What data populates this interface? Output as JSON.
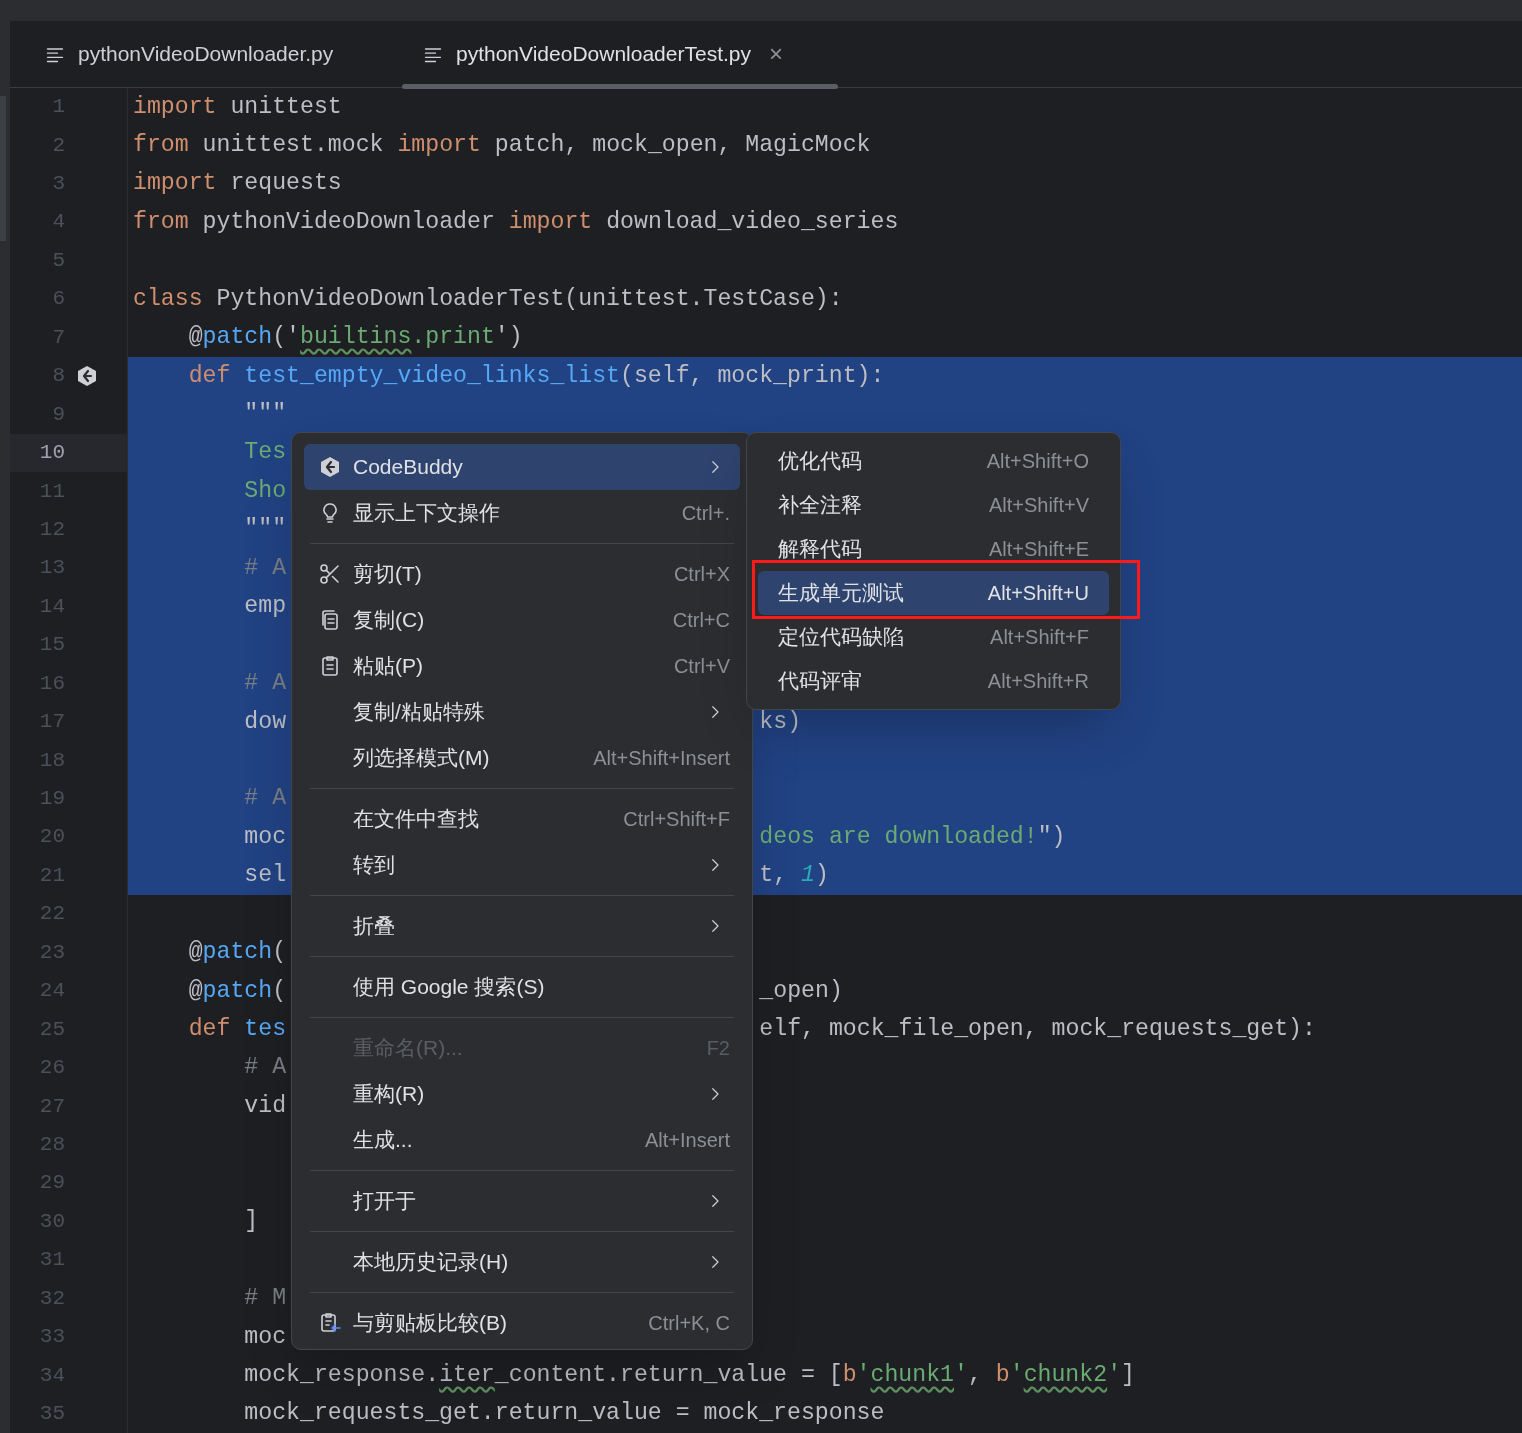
{
  "tabs": [
    {
      "label": "pythonVideoDownloader.py",
      "selected": false
    },
    {
      "label": "pythonVideoDownloaderTest.py",
      "selected": true,
      "close": "×"
    }
  ],
  "editor": {
    "lines": [
      {
        "number": "1",
        "selected": false,
        "current": false,
        "code": [
          {
            "kind": "kw",
            "text": "import"
          },
          {
            "kind": "plain",
            "text": " unittest"
          }
        ]
      },
      {
        "number": "2",
        "selected": false,
        "current": false,
        "code": [
          {
            "kind": "kw",
            "text": "from"
          },
          {
            "kind": "plain",
            "text": " unittest.mock "
          },
          {
            "kind": "kw",
            "text": "import"
          },
          {
            "kind": "plain",
            "text": " patch, mock_open, MagicMock"
          }
        ]
      },
      {
        "number": "3",
        "selected": false,
        "current": false,
        "code": [
          {
            "kind": "kw",
            "text": "import"
          },
          {
            "kind": "plain",
            "text": " requests"
          }
        ]
      },
      {
        "number": "4",
        "selected": false,
        "current": false,
        "code": [
          {
            "kind": "kw",
            "text": "from"
          },
          {
            "kind": "plain",
            "text": " pythonVideoDownloader "
          },
          {
            "kind": "kw",
            "text": "import"
          },
          {
            "kind": "plain",
            "text": " download_video_series"
          }
        ]
      },
      {
        "number": "5",
        "selected": false,
        "current": false
      },
      {
        "number": "6",
        "selected": false,
        "current": false,
        "code": [
          {
            "kind": "kw",
            "text": "class"
          },
          {
            "kind": "plain",
            "text": " PythonVideoDownloaderTest(unittest.TestCase):"
          }
        ]
      },
      {
        "number": "7",
        "selected": false,
        "current": false,
        "code": [
          {
            "kind": "plain",
            "text": "    @"
          },
          {
            "kind": "deco",
            "text": "patch"
          },
          {
            "kind": "plain",
            "text": "('"
          },
          {
            "kind": "str",
            "text": "builtins",
            "typo": true
          },
          {
            "kind": "str",
            "text": ".print"
          },
          {
            "kind": "plain",
            "text": "')"
          }
        ]
      },
      {
        "number": "8",
        "selected": true,
        "current": false,
        "gutter_icon": true,
        "code": [
          {
            "kind": "kw",
            "text": "    def"
          },
          {
            "kind": "fn",
            "text": " test_empty_video_links_list"
          },
          {
            "kind": "plain",
            "text": "(self, mock_print):"
          }
        ]
      },
      {
        "number": "9",
        "selected": true,
        "current": false,
        "code": [
          {
            "kind": "plain",
            "text": "        \"\"\""
          }
        ]
      },
      {
        "number": "10",
        "selected": true,
        "current": true,
        "code": [
          {
            "kind": "str",
            "text": "        Tes"
          }
        ]
      },
      {
        "number": "11",
        "selected": true,
        "current": false,
        "code": [
          {
            "kind": "str",
            "text": "        Sho"
          }
        ]
      },
      {
        "number": "12",
        "selected": true,
        "current": false,
        "code": [
          {
            "kind": "plain",
            "text": "        \"\"\""
          }
        ]
      },
      {
        "number": "13",
        "selected": true,
        "current": false,
        "code": [
          {
            "kind": "comment",
            "text": "        # A"
          }
        ]
      },
      {
        "number": "14",
        "selected": true,
        "current": false,
        "code": [
          {
            "kind": "plain",
            "text": "        emp"
          }
        ]
      },
      {
        "number": "15",
        "selected": true,
        "current": false
      },
      {
        "number": "16",
        "selected": true,
        "current": false,
        "code": [
          {
            "kind": "comment",
            "text": "        # A"
          }
        ]
      },
      {
        "number": "17",
        "selected": true,
        "current": false,
        "code": [
          {
            "kind": "plain",
            "text": "        dow"
          }
        ],
        "after_menu": [
          {
            "kind": "plain",
            "text": "ks)"
          }
        ]
      },
      {
        "number": "18",
        "selected": true,
        "current": false
      },
      {
        "number": "19",
        "selected": true,
        "current": false,
        "code": [
          {
            "kind": "comment",
            "text": "        # A"
          }
        ]
      },
      {
        "number": "20",
        "selected": true,
        "current": false,
        "code": [
          {
            "kind": "plain",
            "text": "        moc"
          }
        ],
        "after_menu": [
          {
            "kind": "str",
            "text": "deos are downloaded!"
          },
          {
            "kind": "plain",
            "text": "\")"
          }
        ]
      },
      {
        "number": "21",
        "selected": true,
        "current": false,
        "code": [
          {
            "kind": "plain",
            "text": "        sel"
          }
        ],
        "after_menu": [
          {
            "kind": "plain",
            "text": "t, "
          },
          {
            "kind": "num",
            "text": "1"
          },
          {
            "kind": "plain",
            "text": ")"
          }
        ]
      },
      {
        "number": "22",
        "selected": false,
        "current": false
      },
      {
        "number": "23",
        "selected": false,
        "current": false,
        "code": [
          {
            "kind": "plain",
            "text": "    @"
          },
          {
            "kind": "deco",
            "text": "patch"
          },
          {
            "kind": "plain",
            "text": "("
          }
        ]
      },
      {
        "number": "24",
        "selected": false,
        "current": false,
        "code": [
          {
            "kind": "plain",
            "text": "    @"
          },
          {
            "kind": "deco",
            "text": "patch"
          },
          {
            "kind": "plain",
            "text": "("
          }
        ],
        "after_menu": [
          {
            "kind": "plain",
            "text": "_open)"
          }
        ]
      },
      {
        "number": "25",
        "selected": false,
        "current": false,
        "code": [
          {
            "kind": "kw",
            "text": "    def"
          },
          {
            "kind": "fn",
            "text": " tes"
          }
        ],
        "after_menu": [
          {
            "kind": "plain",
            "text": "elf, mock_file_open, mock_requests_get):"
          }
        ]
      },
      {
        "number": "26",
        "selected": false,
        "current": false,
        "code": [
          {
            "kind": "comment",
            "text": "        # A"
          }
        ]
      },
      {
        "number": "27",
        "selected": false,
        "current": false,
        "code": [
          {
            "kind": "plain",
            "text": "        vid"
          }
        ]
      },
      {
        "number": "28",
        "selected": false,
        "current": false
      },
      {
        "number": "29",
        "selected": false,
        "current": false
      },
      {
        "number": "30",
        "selected": false,
        "current": false,
        "code": [
          {
            "kind": "plain",
            "text": "        ]"
          }
        ]
      },
      {
        "number": "31",
        "selected": false,
        "current": false
      },
      {
        "number": "32",
        "selected": false,
        "current": false,
        "code": [
          {
            "kind": "comment",
            "text": "        # M"
          }
        ]
      },
      {
        "number": "33",
        "selected": false,
        "current": false,
        "code": [
          {
            "kind": "plain",
            "text": "        moc"
          }
        ]
      },
      {
        "number": "34",
        "selected": false,
        "current": false,
        "code": [
          {
            "kind": "plain",
            "text": "        mock_response."
          },
          {
            "kind": "plain",
            "text": "iter",
            "typo": true
          },
          {
            "kind": "plain",
            "text": "_content.return_value = ["
          },
          {
            "kind": "kw",
            "text": "b"
          },
          {
            "kind": "str",
            "text": "'"
          },
          {
            "kind": "str",
            "text": "chunk1",
            "typo": true
          },
          {
            "kind": "str",
            "text": "'"
          },
          {
            "kind": "plain",
            "text": ", "
          },
          {
            "kind": "kw",
            "text": "b"
          },
          {
            "kind": "str",
            "text": "'"
          },
          {
            "kind": "str",
            "text": "chunk2",
            "typo": true
          },
          {
            "kind": "str",
            "text": "'"
          },
          {
            "kind": "plain",
            "text": "]"
          }
        ]
      },
      {
        "number": "35",
        "selected": false,
        "current": false,
        "code": [
          {
            "kind": "plain",
            "text": "        mock_requests_get.return_value = mock_response"
          }
        ]
      }
    ]
  },
  "context_menu": {
    "items": [
      {
        "kind": "item",
        "label": "CodeBuddy",
        "submenu": true,
        "selected": true,
        "disabled": false
      },
      {
        "kind": "item",
        "label": "显示上下文操作",
        "shortcut": "Ctrl+.",
        "selected": false,
        "disabled": false
      },
      {
        "kind": "separator"
      },
      {
        "kind": "item",
        "label": "剪切(T)",
        "shortcut": "Ctrl+X",
        "selected": false,
        "disabled": false
      },
      {
        "kind": "item",
        "label": "复制(C)",
        "shortcut": "Ctrl+C",
        "selected": false,
        "disabled": false
      },
      {
        "kind": "item",
        "label": "粘贴(P)",
        "shortcut": "Ctrl+V",
        "selected": false,
        "disabled": false
      },
      {
        "kind": "item",
        "label": "复制/粘贴特殊",
        "submenu": true,
        "selected": false,
        "disabled": false
      },
      {
        "kind": "item",
        "label": "列选择模式(M)",
        "shortcut": "Alt+Shift+Insert",
        "selected": false,
        "disabled": false
      },
      {
        "kind": "separator"
      },
      {
        "kind": "item",
        "label": "在文件中查找",
        "shortcut": "Ctrl+Shift+F",
        "selected": false,
        "disabled": false
      },
      {
        "kind": "item",
        "label": "转到",
        "submenu": true,
        "selected": false,
        "disabled": false
      },
      {
        "kind": "separator"
      },
      {
        "kind": "item",
        "label": "折叠",
        "submenu": true,
        "selected": false,
        "disabled": false
      },
      {
        "kind": "separator"
      },
      {
        "kind": "item",
        "label": "使用 Google 搜索(S)",
        "selected": false,
        "disabled": false
      },
      {
        "kind": "separator"
      },
      {
        "kind": "item",
        "label": "重命名(R)...",
        "shortcut": "F2",
        "selected": false,
        "disabled": true
      },
      {
        "kind": "item",
        "label": "重构(R)",
        "submenu": true,
        "selected": false,
        "disabled": false
      },
      {
        "kind": "item",
        "label": "生成...",
        "shortcut": "Alt+Insert",
        "selected": false,
        "disabled": false
      },
      {
        "kind": "separator"
      },
      {
        "kind": "item",
        "label": "打开于",
        "submenu": true,
        "selected": false,
        "disabled": false
      },
      {
        "kind": "separator"
      },
      {
        "kind": "item",
        "label": "本地历史记录(H)",
        "submenu": true,
        "selected": false,
        "disabled": false
      },
      {
        "kind": "separator"
      },
      {
        "kind": "item",
        "label": "与剪贴板比较(B)",
        "shortcut": "Ctrl+K, C",
        "selected": false,
        "disabled": false
      }
    ]
  },
  "submenu": {
    "items": [
      {
        "label": "优化代码",
        "shortcut": "Alt+Shift+O",
        "selected": false,
        "highlighted": false
      },
      {
        "label": "补全注释",
        "shortcut": "Alt+Shift+V",
        "selected": false,
        "highlighted": false
      },
      {
        "label": "解释代码",
        "shortcut": "Alt+Shift+E",
        "selected": false,
        "highlighted": false
      },
      {
        "label": "生成单元测试",
        "shortcut": "Alt+Shift+U",
        "selected": true,
        "highlighted": true
      },
      {
        "label": "定位代码缺陷",
        "shortcut": "Alt+Shift+F",
        "selected": false,
        "highlighted": false
      },
      {
        "label": "代码评审",
        "shortcut": "Alt+Shift+R",
        "selected": false,
        "highlighted": false
      }
    ]
  }
}
